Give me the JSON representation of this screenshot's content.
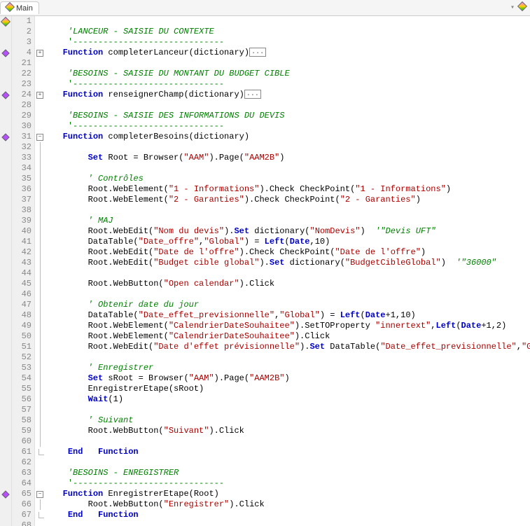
{
  "tab": {
    "title": "Main"
  },
  "collapsed_marker": "...",
  "fold": {
    "plus": "+",
    "minus": "−"
  },
  "lines": [
    {
      "n": 1,
      "marker": "diamond",
      "fold": "",
      "seg": []
    },
    {
      "n": 2,
      "marker": "",
      "fold": "",
      "seg": [
        [
          "    ",
          ""
        ],
        [
          "'LANCEUR - SAISIE DU CONTEXTE",
          "cm"
        ]
      ]
    },
    {
      "n": 3,
      "marker": "",
      "fold": "",
      "seg": [
        [
          "    ",
          ""
        ],
        [
          "'------------------------------",
          "cmdash"
        ]
      ]
    },
    {
      "n": 4,
      "marker": "diamondS",
      "fold": "plus",
      "collapsed": true,
      "seg": [
        [
          "   ",
          ""
        ],
        [
          "Function",
          "kw"
        ],
        [
          " completerLanceur(dictionary)",
          ""
        ]
      ]
    },
    {
      "n": 21,
      "marker": "",
      "fold": "",
      "seg": []
    },
    {
      "n": 22,
      "marker": "",
      "fold": "",
      "seg": [
        [
          "    ",
          ""
        ],
        [
          "'BESOINS - SAISIE DU MONTANT DU BUDGET CIBLE",
          "cm"
        ]
      ]
    },
    {
      "n": 23,
      "marker": "",
      "fold": "",
      "seg": [
        [
          "    ",
          ""
        ],
        [
          "'------------------------------",
          "cmdash"
        ]
      ]
    },
    {
      "n": 24,
      "marker": "diamondS",
      "fold": "plus",
      "collapsed": true,
      "seg": [
        [
          "   ",
          ""
        ],
        [
          "Function",
          "kw"
        ],
        [
          " renseignerChamp(dictionary)",
          ""
        ]
      ]
    },
    {
      "n": 28,
      "marker": "",
      "fold": "",
      "seg": []
    },
    {
      "n": 29,
      "marker": "",
      "fold": "",
      "seg": [
        [
          "    ",
          ""
        ],
        [
          "'BESOINS - SAISIE DES INFORMATIONS DU DEVIS",
          "cm"
        ]
      ]
    },
    {
      "n": 30,
      "marker": "",
      "fold": "",
      "seg": [
        [
          "    ",
          ""
        ],
        [
          "'------------------------------",
          "cmdash"
        ]
      ]
    },
    {
      "n": 31,
      "marker": "diamondS",
      "fold": "minus",
      "seg": [
        [
          "   ",
          ""
        ],
        [
          "Function",
          "kw"
        ],
        [
          " completerBesoins(dictionary)",
          ""
        ]
      ]
    },
    {
      "n": 32,
      "marker": "",
      "fold": "line",
      "seg": []
    },
    {
      "n": 33,
      "marker": "",
      "fold": "line",
      "seg": [
        [
          "        ",
          ""
        ],
        [
          "Set",
          "kw"
        ],
        [
          " Root = Browser(",
          ""
        ],
        [
          "\"AAM\"",
          "str"
        ],
        [
          ").Page(",
          ""
        ],
        [
          "\"AAM2B\"",
          "str"
        ],
        [
          ")",
          ""
        ]
      ]
    },
    {
      "n": 34,
      "marker": "",
      "fold": "line",
      "seg": []
    },
    {
      "n": 35,
      "marker": "",
      "fold": "line",
      "seg": [
        [
          "        ",
          ""
        ],
        [
          "' Contrôles",
          "cm"
        ]
      ]
    },
    {
      "n": 36,
      "marker": "",
      "fold": "line",
      "seg": [
        [
          "        Root.WebElement(",
          ""
        ],
        [
          "\"1 - Informations\"",
          "str"
        ],
        [
          ").Check CheckPoint(",
          ""
        ],
        [
          "\"1 - Informations\"",
          "str"
        ],
        [
          ")",
          ""
        ]
      ]
    },
    {
      "n": 37,
      "marker": "",
      "fold": "line",
      "seg": [
        [
          "        Root.WebElement(",
          ""
        ],
        [
          "\"2 - Garanties\"",
          "str"
        ],
        [
          ").Check CheckPoint(",
          ""
        ],
        [
          "\"2 - Garanties\"",
          "str"
        ],
        [
          ")",
          ""
        ]
      ]
    },
    {
      "n": 38,
      "marker": "",
      "fold": "line",
      "seg": []
    },
    {
      "n": 39,
      "marker": "",
      "fold": "line",
      "seg": [
        [
          "        ",
          ""
        ],
        [
          "' MAJ",
          "cm"
        ]
      ]
    },
    {
      "n": 40,
      "marker": "",
      "fold": "line",
      "seg": [
        [
          "        Root.WebEdit(",
          ""
        ],
        [
          "\"Nom du devis\"",
          "str"
        ],
        [
          ").",
          ""
        ],
        [
          "Set",
          "kw"
        ],
        [
          " dictionary(",
          ""
        ],
        [
          "\"NomDevis\"",
          "str"
        ],
        [
          ")  ",
          ""
        ],
        [
          "'\"Devis UFT\"",
          "cm"
        ]
      ]
    },
    {
      "n": 41,
      "marker": "",
      "fold": "line",
      "seg": [
        [
          "        DataTable(",
          ""
        ],
        [
          "\"Date_offre\"",
          "str"
        ],
        [
          ",",
          ""
        ],
        [
          "\"Global\"",
          "str"
        ],
        [
          ") = ",
          ""
        ],
        [
          "Left",
          "kw"
        ],
        [
          "(",
          ""
        ],
        [
          "Date",
          "kw"
        ],
        [
          ",10)",
          ""
        ]
      ]
    },
    {
      "n": 42,
      "marker": "",
      "fold": "line",
      "seg": [
        [
          "        Root.WebEdit(",
          ""
        ],
        [
          "\"Date de l'offre\"",
          "str"
        ],
        [
          ").Check CheckPoint(",
          ""
        ],
        [
          "\"Date de l'offre\"",
          "str"
        ],
        [
          ")",
          ""
        ]
      ]
    },
    {
      "n": 43,
      "marker": "",
      "fold": "line",
      "seg": [
        [
          "        Root.WebEdit(",
          ""
        ],
        [
          "\"Budget cible global\"",
          "str"
        ],
        [
          ").",
          ""
        ],
        [
          "Set",
          "kw"
        ],
        [
          " dictionary(",
          ""
        ],
        [
          "\"BudgetCibleGlobal\"",
          "str"
        ],
        [
          ")  ",
          ""
        ],
        [
          "'\"36000\"",
          "cm"
        ]
      ]
    },
    {
      "n": 44,
      "marker": "",
      "fold": "line",
      "seg": []
    },
    {
      "n": 45,
      "marker": "",
      "fold": "line",
      "seg": [
        [
          "        Root.WebButton(",
          ""
        ],
        [
          "\"Open calendar\"",
          "str"
        ],
        [
          ").Click",
          ""
        ]
      ]
    },
    {
      "n": 46,
      "marker": "",
      "fold": "line",
      "seg": []
    },
    {
      "n": 47,
      "marker": "",
      "fold": "line",
      "seg": [
        [
          "        ",
          ""
        ],
        [
          "' Obtenir date du jour",
          "cm"
        ]
      ]
    },
    {
      "n": 48,
      "marker": "",
      "fold": "line",
      "seg": [
        [
          "        DataTable(",
          ""
        ],
        [
          "\"Date_effet_previsionnelle\"",
          "str"
        ],
        [
          ",",
          ""
        ],
        [
          "\"Global\"",
          "str"
        ],
        [
          ") = ",
          ""
        ],
        [
          "Left",
          "kw"
        ],
        [
          "(",
          ""
        ],
        [
          "Date",
          "kw"
        ],
        [
          "+1,10)",
          ""
        ]
      ]
    },
    {
      "n": 49,
      "marker": "",
      "fold": "line",
      "seg": [
        [
          "        Root.WebElement(",
          ""
        ],
        [
          "\"CalendrierDateSouhaitee\"",
          "str"
        ],
        [
          ").SetTOProperty ",
          ""
        ],
        [
          "\"innertext\"",
          "str"
        ],
        [
          ",",
          ""
        ],
        [
          "Left",
          "kw"
        ],
        [
          "(",
          ""
        ],
        [
          "Date",
          "kw"
        ],
        [
          "+1,2)",
          ""
        ]
      ]
    },
    {
      "n": 50,
      "marker": "",
      "fold": "line",
      "seg": [
        [
          "        Root.WebElement(",
          ""
        ],
        [
          "\"CalendrierDateSouhaitee\"",
          "str"
        ],
        [
          ").Click",
          ""
        ]
      ]
    },
    {
      "n": 51,
      "marker": "",
      "fold": "line",
      "seg": [
        [
          "        Root.WebEdit(",
          ""
        ],
        [
          "\"Date d'effet prévisionnelle\"",
          "str"
        ],
        [
          ").",
          ""
        ],
        [
          "Set",
          "kw"
        ],
        [
          " DataTable(",
          ""
        ],
        [
          "\"Date_effet_previsionnelle\"",
          "str"
        ],
        [
          ",",
          ""
        ],
        [
          "\"Global\"",
          "str"
        ],
        [
          ")",
          ""
        ]
      ]
    },
    {
      "n": 52,
      "marker": "",
      "fold": "line",
      "seg": []
    },
    {
      "n": 53,
      "marker": "",
      "fold": "line",
      "seg": [
        [
          "        ",
          ""
        ],
        [
          "' Enregistrer",
          "cm"
        ]
      ]
    },
    {
      "n": 54,
      "marker": "",
      "fold": "line",
      "seg": [
        [
          "        ",
          ""
        ],
        [
          "Set",
          "kw"
        ],
        [
          " sRoot = Browser(",
          ""
        ],
        [
          "\"AAM\"",
          "str"
        ],
        [
          ").Page(",
          ""
        ],
        [
          "\"AAM2B\"",
          "str"
        ],
        [
          ")",
          ""
        ]
      ]
    },
    {
      "n": 55,
      "marker": "",
      "fold": "line",
      "seg": [
        [
          "        EnregistrerEtape(sRoot)",
          ""
        ]
      ]
    },
    {
      "n": 56,
      "marker": "",
      "fold": "line",
      "seg": [
        [
          "        ",
          ""
        ],
        [
          "Wait",
          "kw"
        ],
        [
          "(1)",
          ""
        ]
      ]
    },
    {
      "n": 57,
      "marker": "",
      "fold": "line",
      "seg": []
    },
    {
      "n": 58,
      "marker": "",
      "fold": "line",
      "seg": [
        [
          "        ",
          ""
        ],
        [
          "' Suivant",
          "cm"
        ]
      ]
    },
    {
      "n": 59,
      "marker": "",
      "fold": "line",
      "seg": [
        [
          "        Root.WebButton(",
          ""
        ],
        [
          "\"Suivant\"",
          "str"
        ],
        [
          ").Click",
          ""
        ]
      ]
    },
    {
      "n": 60,
      "marker": "",
      "fold": "line",
      "seg": []
    },
    {
      "n": 61,
      "marker": "",
      "fold": "end",
      "seg": [
        [
          "    ",
          ""
        ],
        [
          "End   Function",
          "kw"
        ]
      ]
    },
    {
      "n": 62,
      "marker": "",
      "fold": "",
      "seg": []
    },
    {
      "n": 63,
      "marker": "",
      "fold": "",
      "seg": [
        [
          "    ",
          ""
        ],
        [
          "'BESOINS - ENREGISTRER",
          "cm"
        ]
      ]
    },
    {
      "n": 64,
      "marker": "",
      "fold": "",
      "seg": [
        [
          "    ",
          ""
        ],
        [
          "'------------------------------",
          "cmdash"
        ]
      ]
    },
    {
      "n": 65,
      "marker": "diamondS",
      "fold": "minus",
      "seg": [
        [
          "   ",
          ""
        ],
        [
          "Function",
          "kw"
        ],
        [
          " EnregistrerEtape(Root)",
          ""
        ]
      ]
    },
    {
      "n": 66,
      "marker": "",
      "fold": "line",
      "seg": [
        [
          "        Root.WebButton(",
          ""
        ],
        [
          "\"Enregistrer\"",
          "str"
        ],
        [
          ").Click",
          ""
        ]
      ]
    },
    {
      "n": 67,
      "marker": "",
      "fold": "end",
      "seg": [
        [
          "    ",
          ""
        ],
        [
          "End   Function",
          "kw"
        ]
      ]
    },
    {
      "n": 68,
      "marker": "",
      "fold": "",
      "seg": []
    }
  ]
}
